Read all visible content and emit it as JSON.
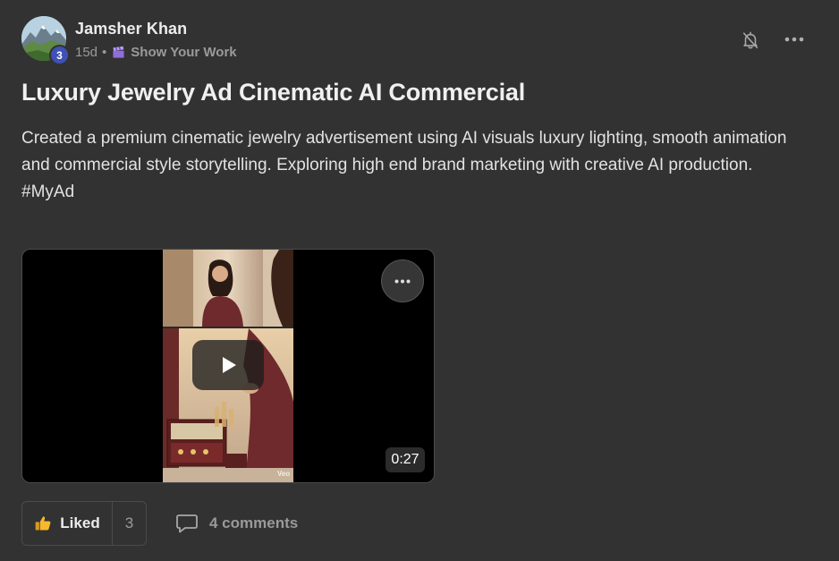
{
  "author": {
    "name": "Jamsher Khan",
    "level": "3",
    "avatar_icon": "mountain-landscape-avatar"
  },
  "meta": {
    "age": "15d",
    "separator": "•",
    "category_icon": "clapperboard-icon",
    "category": "Show Your Work"
  },
  "header_actions": {
    "bell_icon": "bell-off-icon",
    "more_icon": "ellipsis-icon"
  },
  "post": {
    "title": "Luxury Jewelry Ad Cinematic AI Commercial",
    "body": "Created a premium cinematic jewelry advertisement using AI visuals luxury lighting, smooth animation and commercial style storytelling. Exploring high end brand marketing with creative AI production.",
    "hashtag": "#MyAd"
  },
  "video": {
    "duration": "0:27",
    "watermark": "Veo",
    "play_icon": "play-icon",
    "menu_icon": "ellipsis-icon"
  },
  "actions": {
    "like_label": "Liked",
    "like_count": "3",
    "like_icon": "thumbs-up-icon",
    "comments_label": "4 comments",
    "comments_icon": "comment-bubble-icon"
  },
  "colors": {
    "background": "#323232",
    "badge": "#3f51b5",
    "like_icon": "#f5b82e",
    "muted_text": "#9a9a9a"
  }
}
